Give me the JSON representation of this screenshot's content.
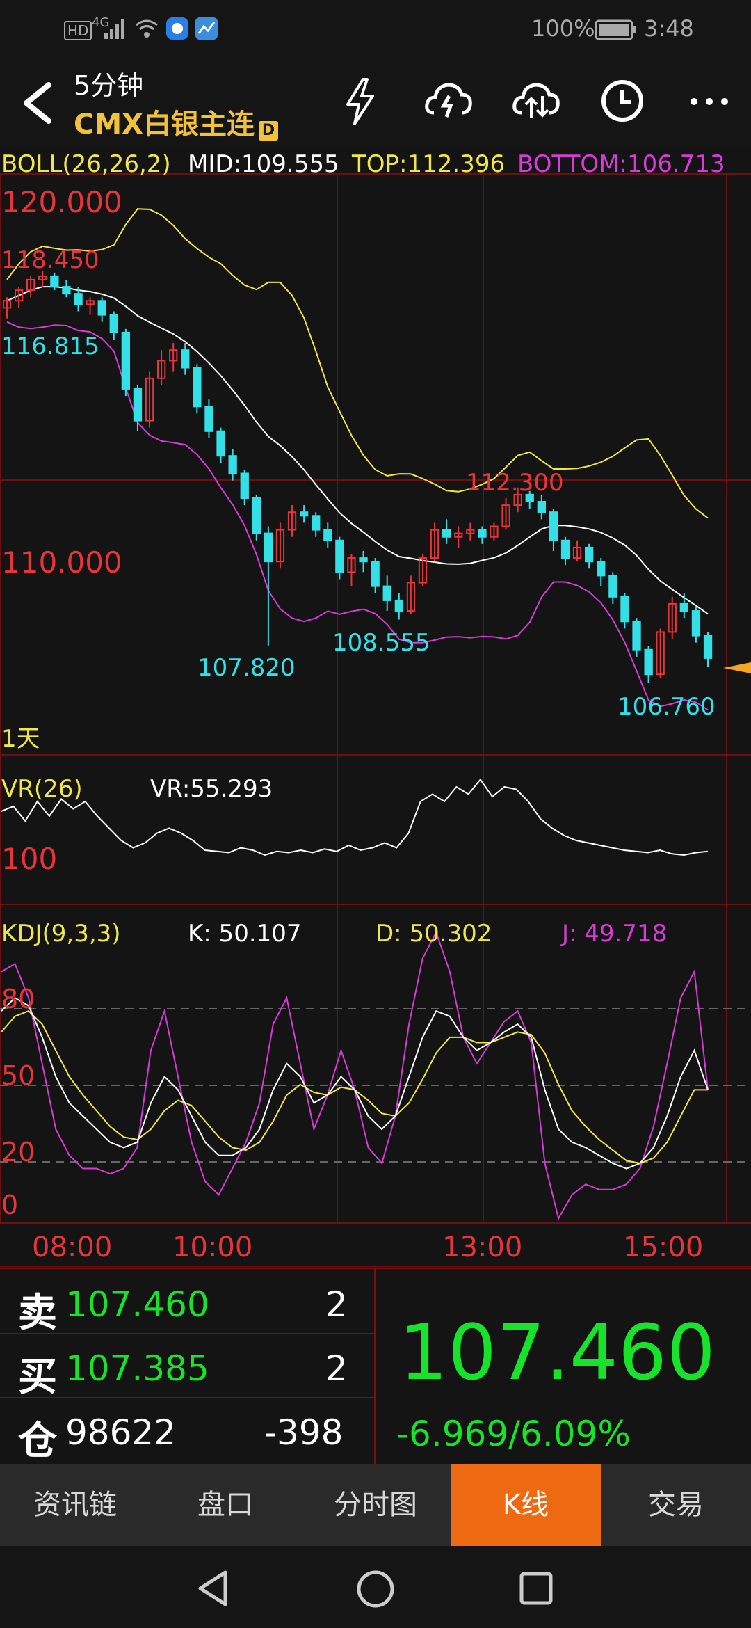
{
  "status": {
    "battery": "100%",
    "time": "3:48",
    "hd": "HD",
    "net": "4G"
  },
  "header": {
    "period": "5分钟",
    "symbol": "CMX白银主连",
    "badge": "D"
  },
  "boll": {
    "name": "BOLL(26,26,2)",
    "mid": "MID:109.555",
    "top": "TOP:112.396",
    "bottom": "BOTTOM:106.713"
  },
  "price_axis": {
    "high": "120.000",
    "low": "110.000"
  },
  "annotations": {
    "a1": "118.450",
    "a2": "116.815",
    "a3": "107.820",
    "a4": "108.555",
    "a5": "112.300",
    "a6": "106.760"
  },
  "period_label": "1天",
  "vr": {
    "name": "VR(26)",
    "value": "VR:55.293",
    "level": "100"
  },
  "kdj": {
    "name": "KDJ(9,3,3)",
    "k": "K: 50.107",
    "d": "D: 50.302",
    "j": "J: 49.718",
    "l80": "80",
    "l50": "50",
    "l20": "20",
    "l0": "0"
  },
  "time_axis": [
    "08:00",
    "10:00",
    "13:00",
    "15:00"
  ],
  "quote": {
    "sell_label": "卖",
    "sell_price": "107.460",
    "sell_qty": "2",
    "buy_label": "买",
    "buy_price": "107.385",
    "buy_qty": "2",
    "oi_label": "仓",
    "oi_value": "98622",
    "oi_change": "-398",
    "last": "107.460",
    "change": "-6.969/6.09%"
  },
  "tabs": [
    "资讯链",
    "盘口",
    "分时图",
    "K线",
    "交易"
  ],
  "colors": {
    "up": "#e8343a",
    "down": "#33e0e8",
    "green": "#17e32a",
    "accent": "#ee6a12",
    "boll_top": "#f0e64a",
    "boll_bottom": "#d83bd8"
  },
  "chart_data": {
    "type": "candlestick",
    "y_range": [
      105.8,
      121.2
    ],
    "candles": [
      [
        117.4,
        117.7,
        117.1,
        117.6
      ],
      [
        117.6,
        118.0,
        117.4,
        117.9
      ],
      [
        117.9,
        118.3,
        117.7,
        118.2
      ],
      [
        118.2,
        118.45,
        118.0,
        118.3
      ],
      [
        118.3,
        118.4,
        117.9,
        118.0
      ],
      [
        118.0,
        118.2,
        117.7,
        117.8
      ],
      [
        117.8,
        118.0,
        117.3,
        117.5
      ],
      [
        117.5,
        117.7,
        117.2,
        117.6
      ],
      [
        117.6,
        117.7,
        117.0,
        117.2
      ],
      [
        117.2,
        117.3,
        116.5,
        116.7
      ],
      [
        116.7,
        116.8,
        114.9,
        115.1
      ],
      [
        115.1,
        115.2,
        113.9,
        114.2
      ],
      [
        114.2,
        115.6,
        114.0,
        115.4
      ],
      [
        115.4,
        116.2,
        115.2,
        115.9
      ],
      [
        115.9,
        116.4,
        115.6,
        116.2
      ],
      [
        116.2,
        116.4,
        115.5,
        115.7
      ],
      [
        115.7,
        115.8,
        114.4,
        114.6
      ],
      [
        114.6,
        114.8,
        113.7,
        113.9
      ],
      [
        113.9,
        114.0,
        113.0,
        113.2
      ],
      [
        113.2,
        113.4,
        112.5,
        112.7
      ],
      [
        112.7,
        112.8,
        111.8,
        112.0
      ],
      [
        112.0,
        112.1,
        110.8,
        111.0
      ],
      [
        111.0,
        111.2,
        107.82,
        110.2
      ],
      [
        110.2,
        111.3,
        110.0,
        111.1
      ],
      [
        111.1,
        111.8,
        110.9,
        111.6
      ],
      [
        111.6,
        111.8,
        111.3,
        111.5
      ],
      [
        111.5,
        111.6,
        110.9,
        111.1
      ],
      [
        111.1,
        111.3,
        110.6,
        110.8
      ],
      [
        110.8,
        110.9,
        109.7,
        109.9
      ],
      [
        109.9,
        110.4,
        109.5,
        110.3
      ],
      [
        110.3,
        110.5,
        109.9,
        110.2
      ],
      [
        110.2,
        110.3,
        109.3,
        109.5
      ],
      [
        109.5,
        109.8,
        108.8,
        109.1
      ],
      [
        109.1,
        109.3,
        108.555,
        108.8
      ],
      [
        108.8,
        109.8,
        108.7,
        109.6
      ],
      [
        109.6,
        110.4,
        109.5,
        110.3
      ],
      [
        110.3,
        111.3,
        110.2,
        111.1
      ],
      [
        111.1,
        111.4,
        110.7,
        110.9
      ],
      [
        110.9,
        111.2,
        110.6,
        111.0
      ],
      [
        111.0,
        111.3,
        110.8,
        111.1
      ],
      [
        111.1,
        111.2,
        110.7,
        110.9
      ],
      [
        110.9,
        111.3,
        110.8,
        111.2
      ],
      [
        111.2,
        112.0,
        111.1,
        111.8
      ],
      [
        111.8,
        112.3,
        111.6,
        112.1
      ],
      [
        112.1,
        112.2,
        111.7,
        111.9
      ],
      [
        111.9,
        112.1,
        111.4,
        111.6
      ],
      [
        111.6,
        111.7,
        110.5,
        110.8
      ],
      [
        110.8,
        110.9,
        110.1,
        110.3
      ],
      [
        110.3,
        110.8,
        110.2,
        110.6
      ],
      [
        110.6,
        110.7,
        110.0,
        110.2
      ],
      [
        110.2,
        110.3,
        109.5,
        109.8
      ],
      [
        109.8,
        109.9,
        109.0,
        109.2
      ],
      [
        109.2,
        109.3,
        108.3,
        108.5
      ],
      [
        108.5,
        108.6,
        107.5,
        107.7
      ],
      [
        107.7,
        107.8,
        106.76,
        107.0
      ],
      [
        107.0,
        108.3,
        106.9,
        108.2
      ],
      [
        108.2,
        109.2,
        108.0,
        109.0
      ],
      [
        109.0,
        109.3,
        108.6,
        108.8
      ],
      [
        108.8,
        108.9,
        107.9,
        108.1
      ],
      [
        108.1,
        108.2,
        107.2,
        107.46
      ]
    ],
    "vr_series": [
      88,
      92,
      80,
      96,
      84,
      98,
      90,
      96,
      84,
      74,
      64,
      58,
      62,
      70,
      74,
      70,
      64,
      56,
      55,
      54,
      58,
      56,
      52,
      55,
      54,
      56,
      54,
      57,
      55,
      60,
      56,
      58,
      62,
      58,
      70,
      96,
      102,
      96,
      108,
      102,
      114,
      100,
      108,
      106,
      96,
      82,
      74,
      68,
      64,
      62,
      60,
      58,
      56,
      55,
      54,
      56,
      53,
      52,
      54,
      55
    ],
    "kdj_k": [
      80,
      85,
      82,
      70,
      55,
      45,
      40,
      35,
      30,
      28,
      30,
      45,
      55,
      50,
      40,
      30,
      25,
      25,
      28,
      35,
      50,
      60,
      55,
      45,
      48,
      55,
      50,
      40,
      35,
      40,
      55,
      70,
      80,
      78,
      70,
      65,
      68,
      72,
      75,
      70,
      50,
      35,
      30,
      28,
      25,
      22,
      20,
      22,
      28,
      40,
      55,
      65,
      50
    ],
    "kdj_d": [
      72,
      78,
      80,
      75,
      65,
      55,
      48,
      42,
      36,
      32,
      31,
      35,
      42,
      46,
      44,
      38,
      32,
      28,
      27,
      30,
      38,
      48,
      52,
      49,
      48,
      51,
      50,
      46,
      41,
      40,
      45,
      54,
      64,
      70,
      70,
      68,
      68,
      70,
      72,
      71,
      64,
      52,
      42,
      36,
      31,
      27,
      23,
      22,
      24,
      30,
      40,
      50,
      50
    ],
    "kdj_j": [
      95,
      98,
      85,
      60,
      35,
      25,
      20,
      20,
      18,
      20,
      28,
      65,
      80,
      55,
      30,
      15,
      10,
      20,
      30,
      45,
      75,
      85,
      60,
      35,
      48,
      65,
      50,
      28,
      22,
      40,
      75,
      100,
      110,
      95,
      70,
      60,
      68,
      76,
      80,
      68,
      22,
      1,
      10,
      14,
      12,
      12,
      14,
      20,
      36,
      60,
      85,
      95,
      50
    ],
    "time_labels": [
      "08:00",
      "10:00",
      "13:00",
      "15:00"
    ],
    "boll_params": "BOLL(26,26,2)"
  }
}
